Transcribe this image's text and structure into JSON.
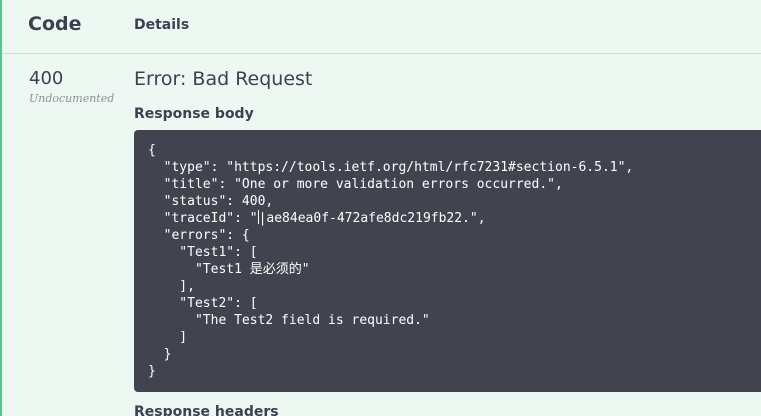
{
  "table": {
    "code_header": "Code",
    "details_header": "Details"
  },
  "response": {
    "code": "400",
    "documentation": "Undocumented",
    "title": "Error: Bad Request",
    "body_label": "Response body",
    "headers_label": "Response headers",
    "body_lines": [
      "{",
      "  \"type\": \"https://tools.ietf.org/html/rfc7231#section-6.5.1\",",
      "  \"title\": \"One or more validation errors occurred.\",",
      "  \"status\": 400,",
      "  \"traceId\": \"",
      "  \"errors\": {",
      "    \"Test1\": [",
      "      \"Test1 是必须的\"",
      "    ],",
      "    \"Test2\": [",
      "      \"The Test2 field is required.\"",
      "    ]",
      "  }",
      "}"
    ],
    "trace_value": "|ae84ea0f-472afe8dc219fb22.\","
  }
}
